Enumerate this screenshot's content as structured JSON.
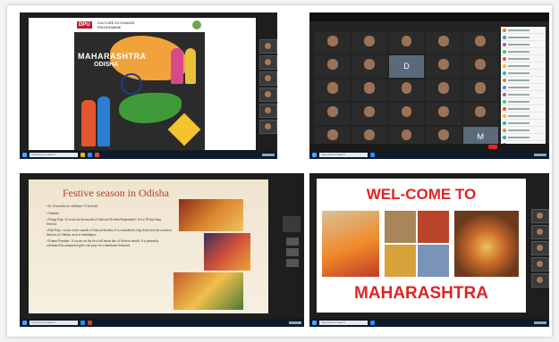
{
  "taskbar": {
    "search_placeholder": "Type here to search"
  },
  "panel1": {
    "logo": "DPU",
    "program_title": "CULTURE EXCHANGE PROGRAMME",
    "state1": "MAHARASHTRA",
    "state2": "ODISHA"
  },
  "panel2": {
    "tiles": [
      {
        "name": ""
      },
      {
        "name": ""
      },
      {
        "name": ""
      },
      {
        "name": ""
      },
      {
        "name": ""
      },
      {
        "name": ""
      },
      {
        "name": ""
      },
      {
        "name": "",
        "letter": "D"
      },
      {
        "name": ""
      },
      {
        "name": ""
      },
      {
        "name": ""
      },
      {
        "name": ""
      },
      {
        "name": ""
      },
      {
        "name": ""
      },
      {
        "name": ""
      },
      {
        "name": ""
      },
      {
        "name": ""
      },
      {
        "name": ""
      },
      {
        "name": ""
      },
      {
        "name": ""
      },
      {
        "name": ""
      },
      {
        "name": ""
      },
      {
        "name": ""
      },
      {
        "name": ""
      },
      {
        "name": "",
        "letter": "M"
      }
    ]
  },
  "panel3": {
    "title": "Festive season in Odisha",
    "bullets": [
      "In 12 months we celebrate 13 festivals",
      "Autumn",
      "Durga Puja : It occurs in the month of Ashwin (October/September). It is a 10-day-long festival.",
      "Kali Puja : occurs in the month of Ashwin/Kartika. It is considered a big festival in the northern districts of Odisha, such as Sambalpur.",
      "Kumar Purnima : It occurs on the first full moon day of Ashwin month. It is primarily celebrated by unmarried girls who pray for a handsome husband."
    ]
  },
  "panel4": {
    "line1": "WEL-COME TO",
    "line2": "MAHARASHTRA"
  },
  "colors": {
    "accent_red": "#e02424",
    "taskbar": "#0d1a2a"
  }
}
